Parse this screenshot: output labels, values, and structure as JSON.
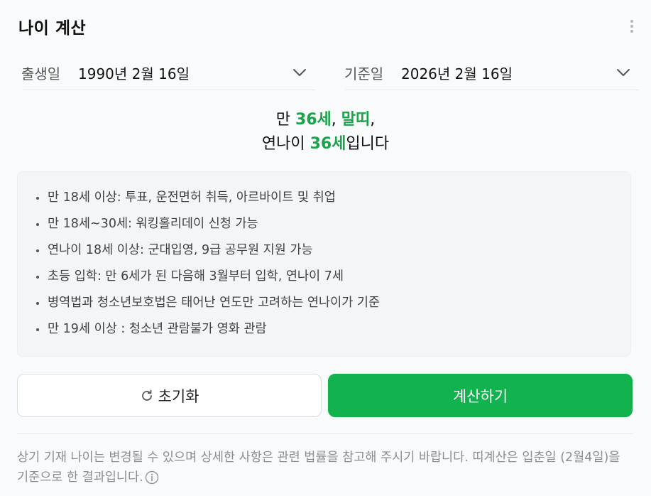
{
  "header": {
    "title": "나이 계산"
  },
  "birth": {
    "label": "출생일",
    "value": "1990년 2월 16일"
  },
  "base": {
    "label": "기준일",
    "value": "2026년 2월 16일"
  },
  "result": {
    "line1_prefix": "만 ",
    "man_age": "36세",
    "comma1": ", ",
    "zodiac": "말띠",
    "comma2": ",",
    "line2_prefix": "연나이 ",
    "yeon_age": "36세",
    "line2_suffix": "입니다"
  },
  "info": {
    "items": [
      "만 18세 이상: 투표, 운전면허 취득, 아르바이트 및 취업",
      "만 18세~30세: 워킹홀리데이 신청 가능",
      "연나이 18세 이상: 군대입영, 9급 공무원 지원 가능",
      "초등 입학: 만 6세가 된 다음해 3월부터 입학, 연나이 7세",
      "병역법과 청소년보호법은 태어난 연도만 고려하는 연나이가 기준",
      "만 19세 이상 : 청소년 관람불가 영화 관람"
    ]
  },
  "buttons": {
    "reset_label": "초기화",
    "calc_label": "계산하기"
  },
  "notice": {
    "text": "상기 기재 나이는 변경될 수 있으며 상세한 사항은 관련 법률을 참고해 주시기 바랍니다. 띠계산은 입춘일 (2월4일)을 기준으로 한 결과입니다."
  },
  "colors": {
    "accent": "#12b24f",
    "highlight": "#1aa34a"
  },
  "icons": {
    "menu": "kebab-menu-icon",
    "dropdown": "chevron-down-icon",
    "reset": "refresh-icon",
    "info": "info-circle-icon"
  }
}
